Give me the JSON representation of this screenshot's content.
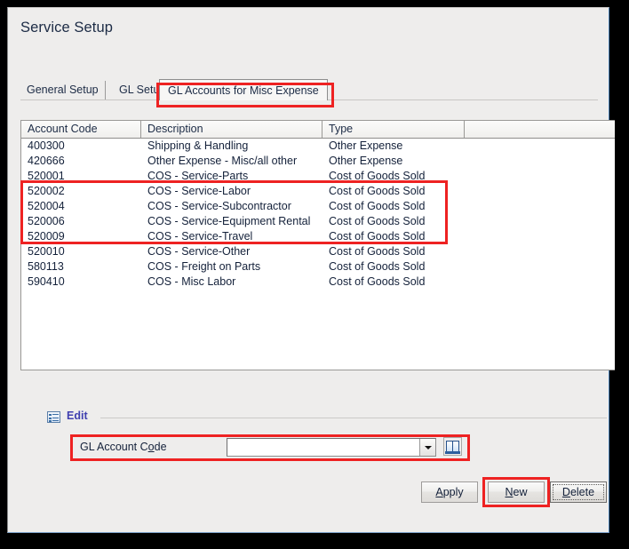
{
  "window": {
    "title": "Service Setup"
  },
  "tabs": [
    {
      "label": "General Setup",
      "active": false
    },
    {
      "label": "GL Setup",
      "active": false
    },
    {
      "label": "GL Accounts for Misc Expense",
      "active": true
    }
  ],
  "grid": {
    "columns": [
      "Account Code",
      "Description",
      "Type",
      ""
    ],
    "rows": [
      {
        "code": "400300",
        "description": "Shipping & Handling",
        "type": "Other Expense"
      },
      {
        "code": "420666",
        "description": "Other Expense - Misc/all other",
        "type": "Other Expense"
      },
      {
        "code": "520001",
        "description": "COS - Service-Parts",
        "type": "Cost of Goods Sold"
      },
      {
        "code": "520002",
        "description": "COS - Service-Labor",
        "type": "Cost of Goods Sold"
      },
      {
        "code": "520004",
        "description": "COS - Service-Subcontractor",
        "type": "Cost of Goods Sold"
      },
      {
        "code": "520006",
        "description": "COS - Service-Equipment Rental",
        "type": "Cost of Goods Sold"
      },
      {
        "code": "520009",
        "description": "COS - Service-Travel",
        "type": "Cost of Goods Sold"
      },
      {
        "code": "520010",
        "description": "COS - Service-Other",
        "type": "Cost of Goods Sold"
      },
      {
        "code": "580113",
        "description": "COS - Freight on Parts",
        "type": "Cost of Goods Sold"
      },
      {
        "code": "590410",
        "description": "COS - Misc Labor",
        "type": "Cost of Goods Sold"
      }
    ]
  },
  "edit_section": {
    "label": "Edit",
    "icon": "form-list-icon"
  },
  "field": {
    "label_prefix": "GL Account C",
    "label_accel": "o",
    "label_suffix": "de",
    "value": "",
    "placeholder": "",
    "dropdown_icon": "chevron-down-icon",
    "lookup_icon": "book-lookup-icon"
  },
  "buttons": {
    "apply": {
      "accel": "A",
      "rest": "pply"
    },
    "new": {
      "accel": "N",
      "rest": "ew"
    },
    "delete": {
      "accel": "D",
      "rest": "elete"
    }
  },
  "annotations": {
    "highlight_color": "#ee2222",
    "boxes": [
      "active-tab",
      "grid-rows-520001-520006",
      "gl-account-code-field",
      "new-button"
    ]
  }
}
